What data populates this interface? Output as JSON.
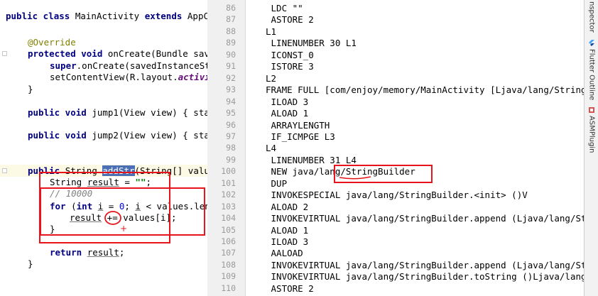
{
  "java_editor": {
    "lines": [
      {
        "parts": [
          [
            "kw",
            "public class "
          ],
          [
            "",
            "MainActivity "
          ],
          [
            "kw",
            "extends "
          ],
          [
            "",
            "AppCo"
          ]
        ]
      },
      {
        "parts": []
      },
      {
        "parts": [
          [
            "ann",
            "@Override"
          ]
        ]
      },
      {
        "parts": [
          [
            "kw",
            "protected void "
          ],
          [
            "",
            "onCreate(Bundle save"
          ]
        ]
      },
      {
        "parts": [
          [
            "kw",
            "super"
          ],
          [
            "",
            ".onCreate(savedInstanceSta"
          ]
        ]
      },
      {
        "parts": [
          [
            "",
            "setContentView(R.layout."
          ],
          [
            "it",
            "activi"
          ]
        ]
      },
      {
        "parts": [
          [
            "",
            "}"
          ]
        ]
      },
      {
        "parts": []
      },
      {
        "parts": [
          [
            "kw",
            "public void "
          ],
          [
            "",
            "jump1(View view) { sta"
          ]
        ]
      },
      {
        "parts": []
      },
      {
        "parts": [
          [
            "kw",
            "public void "
          ],
          [
            "",
            "jump2(View view) { sta"
          ]
        ]
      },
      {
        "parts": []
      },
      {
        "parts": []
      },
      {
        "parts": [
          [
            "kw",
            "public "
          ],
          [
            "",
            "String "
          ],
          [
            "sel",
            "addStr"
          ],
          [
            "",
            "(String[] value"
          ]
        ]
      },
      {
        "parts": [
          [
            "",
            "String "
          ],
          [
            "ul",
            "result"
          ],
          [
            "",
            " = "
          ],
          [
            "str",
            "\"\""
          ],
          [
            "",
            ";"
          ]
        ]
      },
      {
        "parts": [
          [
            "cmt",
            "// 10000"
          ]
        ]
      },
      {
        "parts": [
          [
            "kw",
            "for "
          ],
          [
            "",
            "("
          ],
          [
            "kw",
            "int "
          ],
          [
            "ul",
            "i"
          ],
          [
            "",
            " = "
          ],
          [
            "num",
            "0"
          ],
          [
            "",
            "; "
          ],
          [
            "ul",
            "i"
          ],
          [
            "",
            " < values.len"
          ]
        ]
      },
      {
        "parts": [
          [
            "ul",
            "result"
          ],
          [
            "",
            " += values[i];"
          ]
        ]
      },
      {
        "parts": [
          [
            "",
            "}"
          ]
        ]
      },
      {
        "parts": []
      },
      {
        "parts": [
          [
            "kw",
            "return "
          ],
          [
            "ul",
            "result"
          ],
          [
            "",
            ";"
          ]
        ]
      },
      {
        "parts": [
          [
            "",
            "}"
          ]
        ]
      }
    ]
  },
  "bytecode": {
    "line_numbers": [
      "86",
      "87",
      "88",
      "89",
      "90",
      "91",
      "92",
      "93",
      "94",
      "95",
      "96",
      "97",
      "98",
      "99",
      "100",
      "101",
      "102",
      "103",
      "104",
      "105",
      "106",
      "107",
      "108",
      "109",
      "110"
    ],
    "lines": [
      " LDC \"\"",
      " ASTORE 2",
      "L1",
      " LINENUMBER 30 L1",
      " ICONST_0",
      " ISTORE 3",
      "L2",
      "FRAME FULL [com/enjoy/memory/MainActivity [Ljava/lang/String",
      " ILOAD 3",
      " ALOAD 1",
      " ARRAYLENGTH",
      " IF_ICMPGE L3",
      "L4",
      " LINENUMBER 31 L4",
      " NEW java/lang/StringBuilder",
      " DUP",
      " INVOKESPECIAL java/lang/StringBuilder.<init> ()V",
      " ALOAD 2",
      " INVOKEVIRTUAL java/lang/StringBuilder.append (Ljava/lang/Str",
      " ALOAD 1",
      " ILOAD 3",
      " AALOAD",
      " INVOKEVIRTUAL java/lang/StringBuilder.append (Ljava/lang/Str",
      " INVOKEVIRTUAL java/lang/StringBuilder.toString ()Ljava/lang/",
      " ASTORE 2"
    ]
  },
  "tool_windows": {
    "tabs": [
      {
        "label": "nspector",
        "icon": "inspector-icon"
      },
      {
        "label": "Flutter Outline",
        "icon": "flutter-icon"
      },
      {
        "label": "ASMPlugin",
        "icon": "asm-plugin-icon"
      }
    ]
  },
  "annotations": {
    "plus_mark": "+"
  },
  "colors": {
    "annotation_red": "#e8141c",
    "keyword": "#000080",
    "selection": "#4a6fb5",
    "gutter": "#f0f0f0"
  }
}
